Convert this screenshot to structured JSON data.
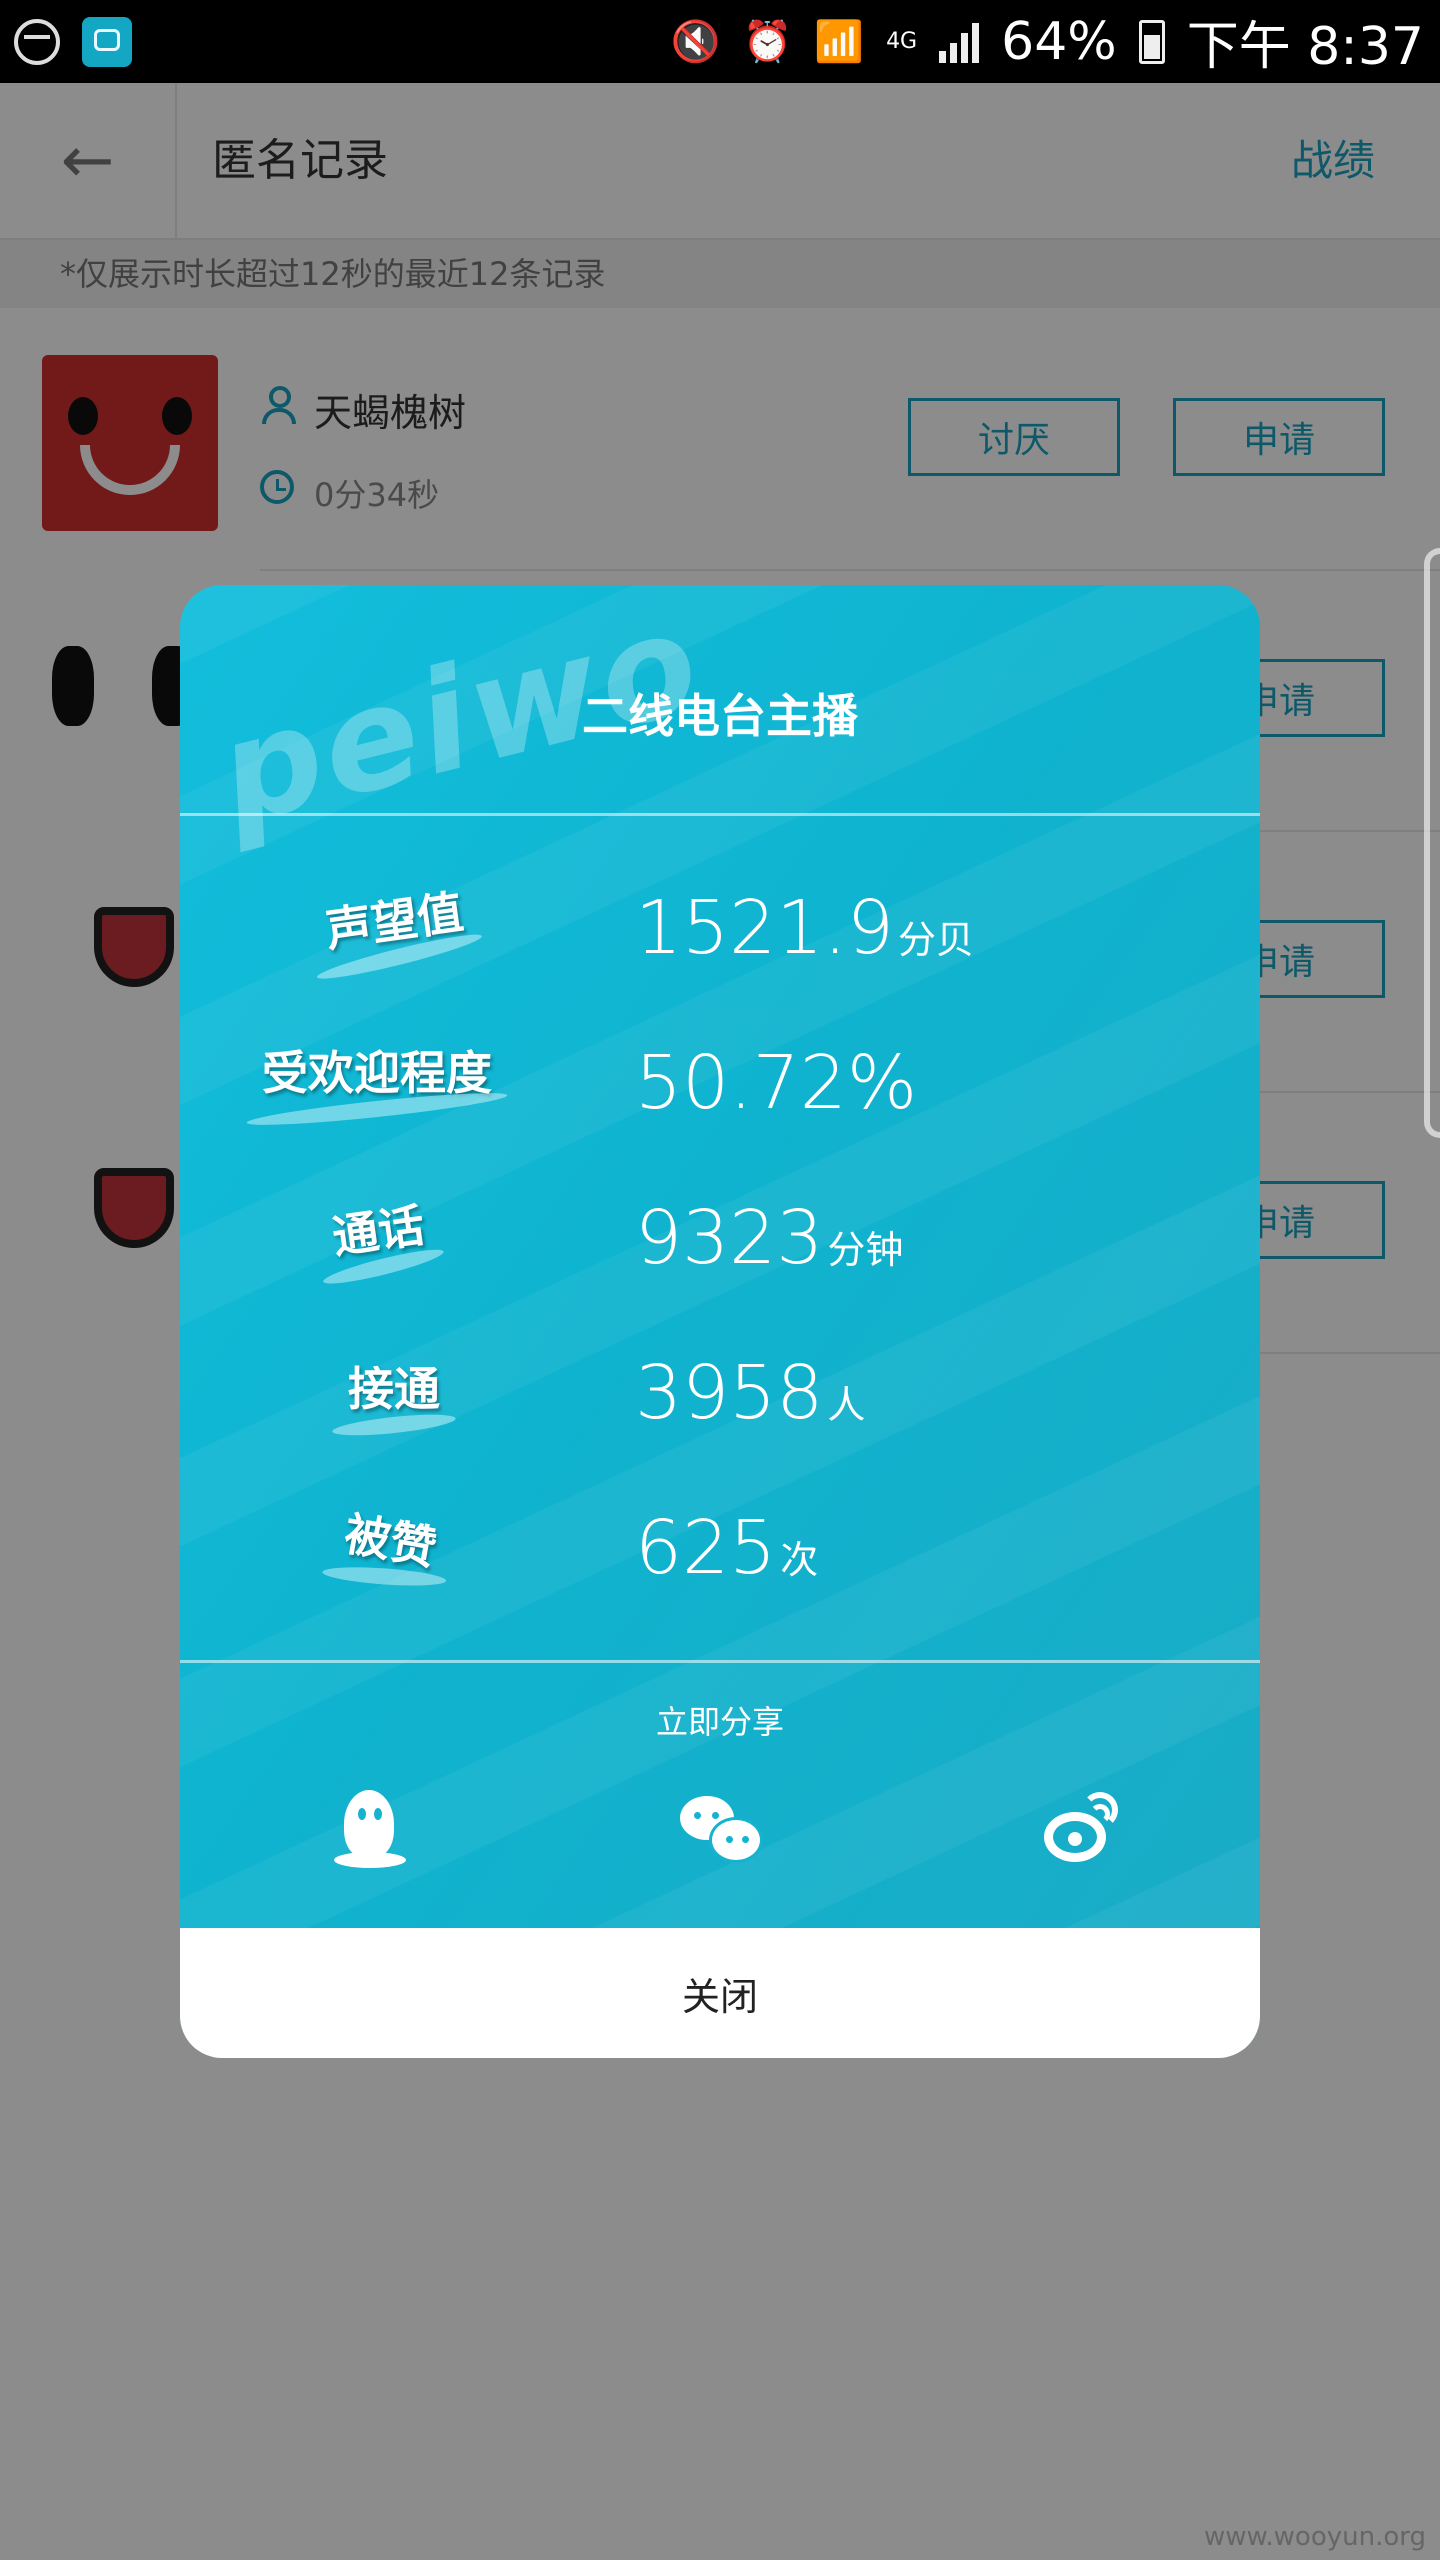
{
  "status_bar": {
    "battery": "64%",
    "network": "4G",
    "time": "下午 8:37"
  },
  "header": {
    "title": "匿名记录",
    "right_link": "战绩"
  },
  "notice": "*仅展示时长超过12秒的最近12条记录",
  "records": [
    {
      "name": "天蝎槐树",
      "duration": "0分34秒",
      "dislike_label": "讨厌",
      "apply_label": "申请"
    },
    {
      "apply_label": "申请"
    },
    {
      "apply_label": "申请"
    },
    {
      "apply_label": "申请"
    }
  ],
  "dialog": {
    "watermark": "peiwo",
    "title": "二线电台主播",
    "stats": [
      {
        "label": "声望值",
        "value": "1521.9",
        "unit": "分贝"
      },
      {
        "label": "受欢迎程度",
        "value": "50.72%",
        "unit": ""
      },
      {
        "label": "通话",
        "value": "9323",
        "unit": "分钟"
      },
      {
        "label": "接通",
        "value": "3958",
        "unit": "人"
      },
      {
        "label": "被赞",
        "value": "625",
        "unit": "次"
      }
    ],
    "share_label": "立即分享",
    "share_targets": [
      "qq-icon",
      "wechat-icon",
      "weibo-icon"
    ],
    "close_label": "关闭"
  },
  "footer_watermark": "www.wooyun.org",
  "colors": {
    "accent": "#1aa3c0",
    "dialog": "#12bedc"
  }
}
